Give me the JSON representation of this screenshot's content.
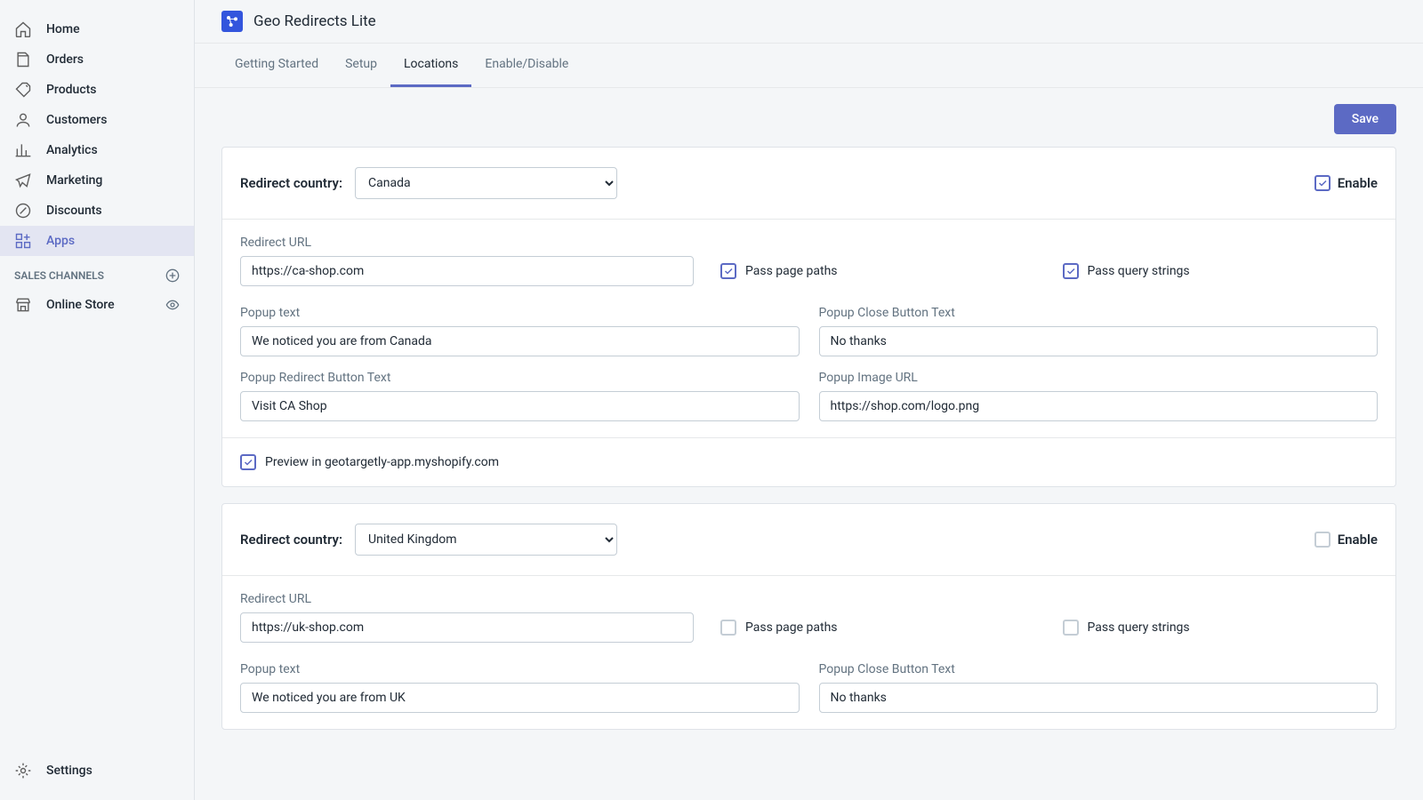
{
  "sidebar": {
    "items": [
      {
        "label": "Home"
      },
      {
        "label": "Orders"
      },
      {
        "label": "Products"
      },
      {
        "label": "Customers"
      },
      {
        "label": "Analytics"
      },
      {
        "label": "Marketing"
      },
      {
        "label": "Discounts"
      },
      {
        "label": "Apps"
      }
    ],
    "section_label": "SALES CHANNELS",
    "channels": [
      {
        "label": "Online Store"
      }
    ],
    "settings_label": "Settings"
  },
  "app": {
    "title": "Geo Redirects Lite"
  },
  "tabs": [
    {
      "label": "Getting Started"
    },
    {
      "label": "Setup"
    },
    {
      "label": "Locations"
    },
    {
      "label": "Enable/Disable"
    }
  ],
  "buttons": {
    "save": "Save"
  },
  "labels": {
    "redirect_country": "Redirect country:",
    "enable": "Enable",
    "redirect_url": "Redirect URL",
    "pass_page_paths": "Pass page paths",
    "pass_query_strings": "Pass query strings",
    "popup_text": "Popup text",
    "popup_close_text": "Popup Close Button Text",
    "popup_redirect_text": "Popup Redirect Button Text",
    "popup_image_url": "Popup Image URL",
    "preview": "Preview in geotargetly-app.myshopify.com"
  },
  "cards": [
    {
      "country": "Canada",
      "enabled": true,
      "redirect_url": "https://ca-shop.com",
      "pass_paths": true,
      "pass_query": true,
      "popup_text": "We noticed you are from Canada",
      "popup_close": "No thanks",
      "popup_redirect": "Visit CA Shop",
      "popup_image": "https://shop.com/logo.png",
      "preview": true
    },
    {
      "country": "United Kingdom",
      "enabled": false,
      "redirect_url": "https://uk-shop.com",
      "pass_paths": false,
      "pass_query": false,
      "popup_text": "We noticed you are from UK",
      "popup_close": "No thanks"
    }
  ]
}
